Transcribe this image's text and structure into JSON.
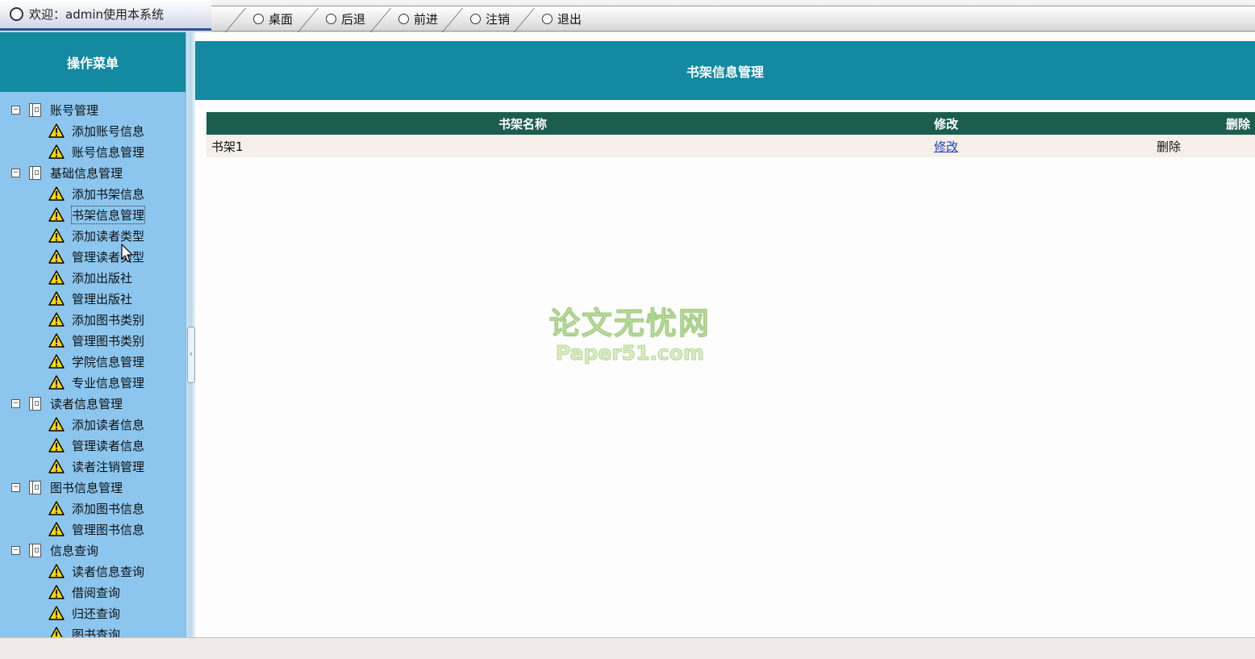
{
  "header": {
    "welcome_text": "欢迎：admin使用本系统",
    "nav": [
      "桌面",
      "后退",
      "前进",
      "注销",
      "退出"
    ]
  },
  "sidebar": {
    "title": "操作菜单",
    "groups": [
      {
        "label": "账号管理",
        "items": [
          "添加账号信息",
          "账号信息管理"
        ]
      },
      {
        "label": "基础信息管理",
        "items": [
          "添加书架信息",
          "书架信息管理",
          "添加读者类型",
          "管理读者类型",
          "添加出版社",
          "管理出版社",
          "添加图书类别",
          "管理图书类别",
          "学院信息管理",
          "专业信息管理"
        ]
      },
      {
        "label": "读者信息管理",
        "items": [
          "添加读者信息",
          "管理读者信息",
          "读者注销管理"
        ]
      },
      {
        "label": "图书信息管理",
        "items": [
          "添加图书信息",
          "管理图书信息"
        ]
      },
      {
        "label": "信息查询",
        "items": [
          "读者信息查询",
          "借阅查询",
          "归还查询",
          "图书查询"
        ]
      }
    ],
    "active_item": "书架信息管理"
  },
  "main": {
    "title": "书架信息管理",
    "table": {
      "columns": [
        "书架名称",
        "修改",
        "删除"
      ],
      "rows": [
        {
          "name": "书架1",
          "edit": "修改",
          "delete": "删除"
        }
      ]
    }
  },
  "watermark": {
    "cn": "论文无忧网",
    "en": "Paper51.com"
  },
  "colors": {
    "header_teal": "#138aa1",
    "sidebar_blue": "#8cc6ef",
    "table_header": "#1b5e4f",
    "table_row": "#f5eee9",
    "link_blue": "#1f3fbf"
  },
  "icons": {
    "group": "book-icon",
    "item": "warning-icon",
    "toggle": "collapse-minus-icon",
    "nav": "circle-icon"
  }
}
